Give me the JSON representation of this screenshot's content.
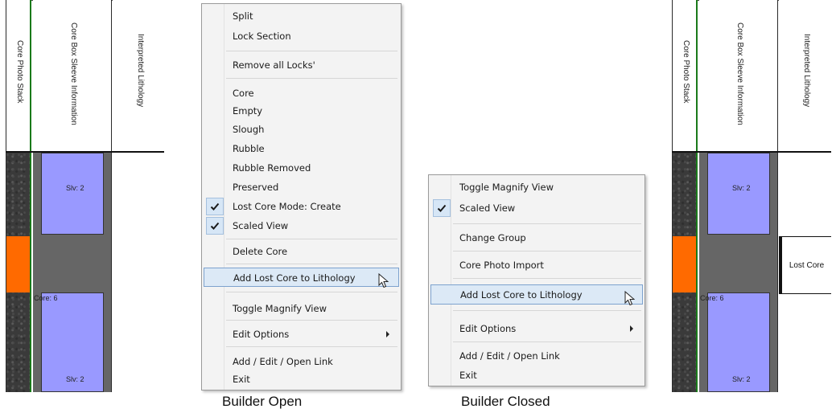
{
  "columns": {
    "photo": "Core Photo Stack",
    "sleeve": "Core Box Sleeve Information",
    "lithology": "Interpreted Lithology"
  },
  "left_panel": {
    "block1_label": "Slv: 2",
    "block2_top_label": "Core: 6",
    "block2_bottom_label": "Slv: 2"
  },
  "right_panel": {
    "block1_label": "Slv: 2",
    "block2_top_label": "Core: 6",
    "block2_bottom_label": "Slv: 2",
    "lost_core_label": "Lost Core"
  },
  "menu_open": {
    "items": [
      "Split",
      "Lock Section",
      "Remove all Locks'",
      "Core",
      "Empty",
      "Slough",
      "Rubble",
      "Rubble Removed",
      "Preserved",
      "Lost Core Mode: Create",
      "Scaled View",
      "Delete Core",
      "Add Lost Core to Lithology",
      "Toggle Magnify View",
      "Edit Options",
      "Add / Edit / Open Link",
      "Exit"
    ],
    "checked": [
      "Lost Core Mode: Create",
      "Scaled View"
    ],
    "highlighted": "Add Lost Core to Lithology"
  },
  "menu_closed": {
    "items": [
      "Toggle Magnify View",
      "Scaled View",
      "Change Group",
      "Core Photo Import",
      "Add Lost Core to Lithology",
      "Edit Options",
      "Add / Edit / Open Link",
      "Exit"
    ],
    "checked": [
      "Scaled View"
    ],
    "highlighted": "Add Lost Core to Lithology"
  },
  "captions": {
    "open": "Builder Open",
    "closed": "Builder Closed"
  },
  "colors": {
    "sleeve_block": "#9999ff",
    "photo_orange": "#ff6a00",
    "sleeve_gray": "#666666",
    "highlight_bg": "#dce9f6",
    "highlight_border": "#7da2ce",
    "column_border_green": "#1a7a1a"
  },
  "icons": [
    "check-icon",
    "submenu-arrow-icon",
    "mouse-pointer-icon"
  ]
}
